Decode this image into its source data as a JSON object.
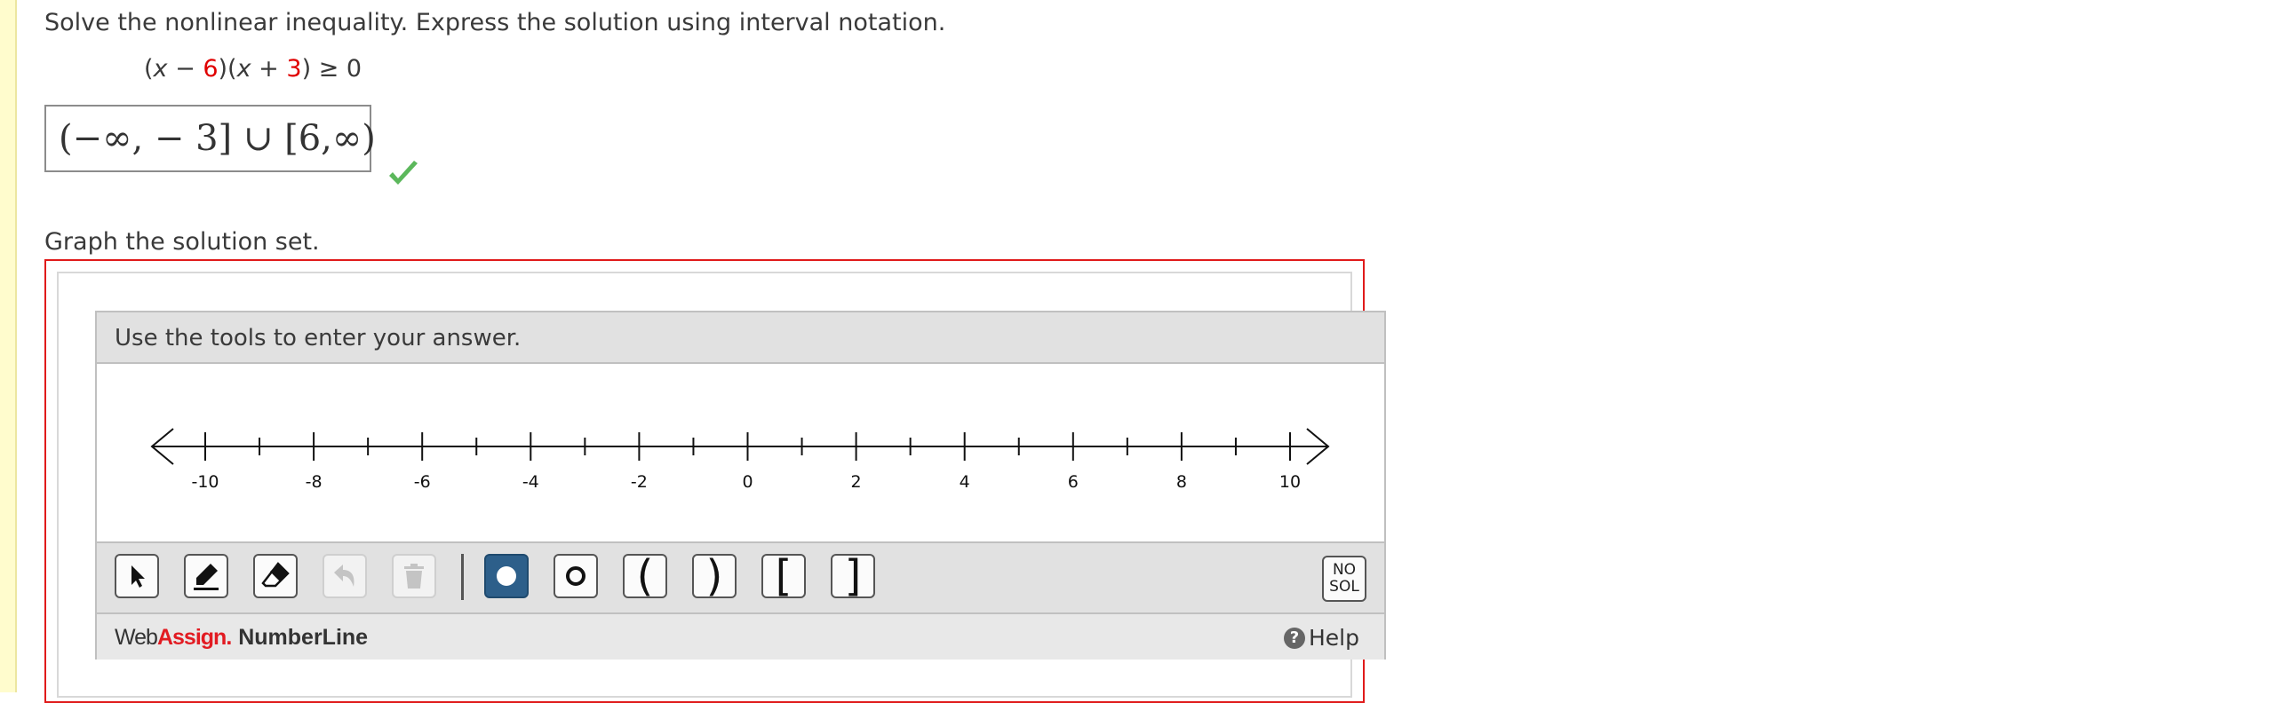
{
  "question": {
    "instruction": "Solve the nonlinear inequality. Express the solution using interval notation.",
    "equation": {
      "p1": "(",
      "var1": "x",
      "op1": " − ",
      "num1": "6",
      "p2": ")(",
      "var2": "x",
      "op2": " + ",
      "num2": "3",
      "p3": ") ≥ 0"
    },
    "answer": "(−∞, − 3] ∪ [6,∞)",
    "graph_prompt": "Graph the solution set."
  },
  "numberline_tool": {
    "header": "Use the tools to enter your answer.",
    "tick_labels": [
      "-10",
      "-8",
      "-6",
      "-4",
      "-2",
      "0",
      "2",
      "4",
      "6",
      "8",
      "10"
    ],
    "axis_range": [
      -10,
      10
    ],
    "tools": {
      "select": "pointer-icon",
      "pencil": "pencil-icon",
      "eraser": "eraser-icon",
      "undo": "undo-icon",
      "trash": "trash-icon",
      "closed_dot": "filled-dot-icon",
      "open_dot": "open-dot-icon",
      "open_left": "(",
      "open_right": ")",
      "closed_left": "[",
      "closed_right": "]",
      "no_solution_line1": "NO",
      "no_solution_line2": "SOL"
    },
    "brand": {
      "web": "Web",
      "assign": "Assign",
      "dot": ".",
      "product": " NumberLine"
    },
    "help_label": "Help"
  },
  "colors": {
    "accent_red": "#e21b22",
    "check_green": "#5cb85c",
    "active_tool": "#2d5f8a"
  }
}
